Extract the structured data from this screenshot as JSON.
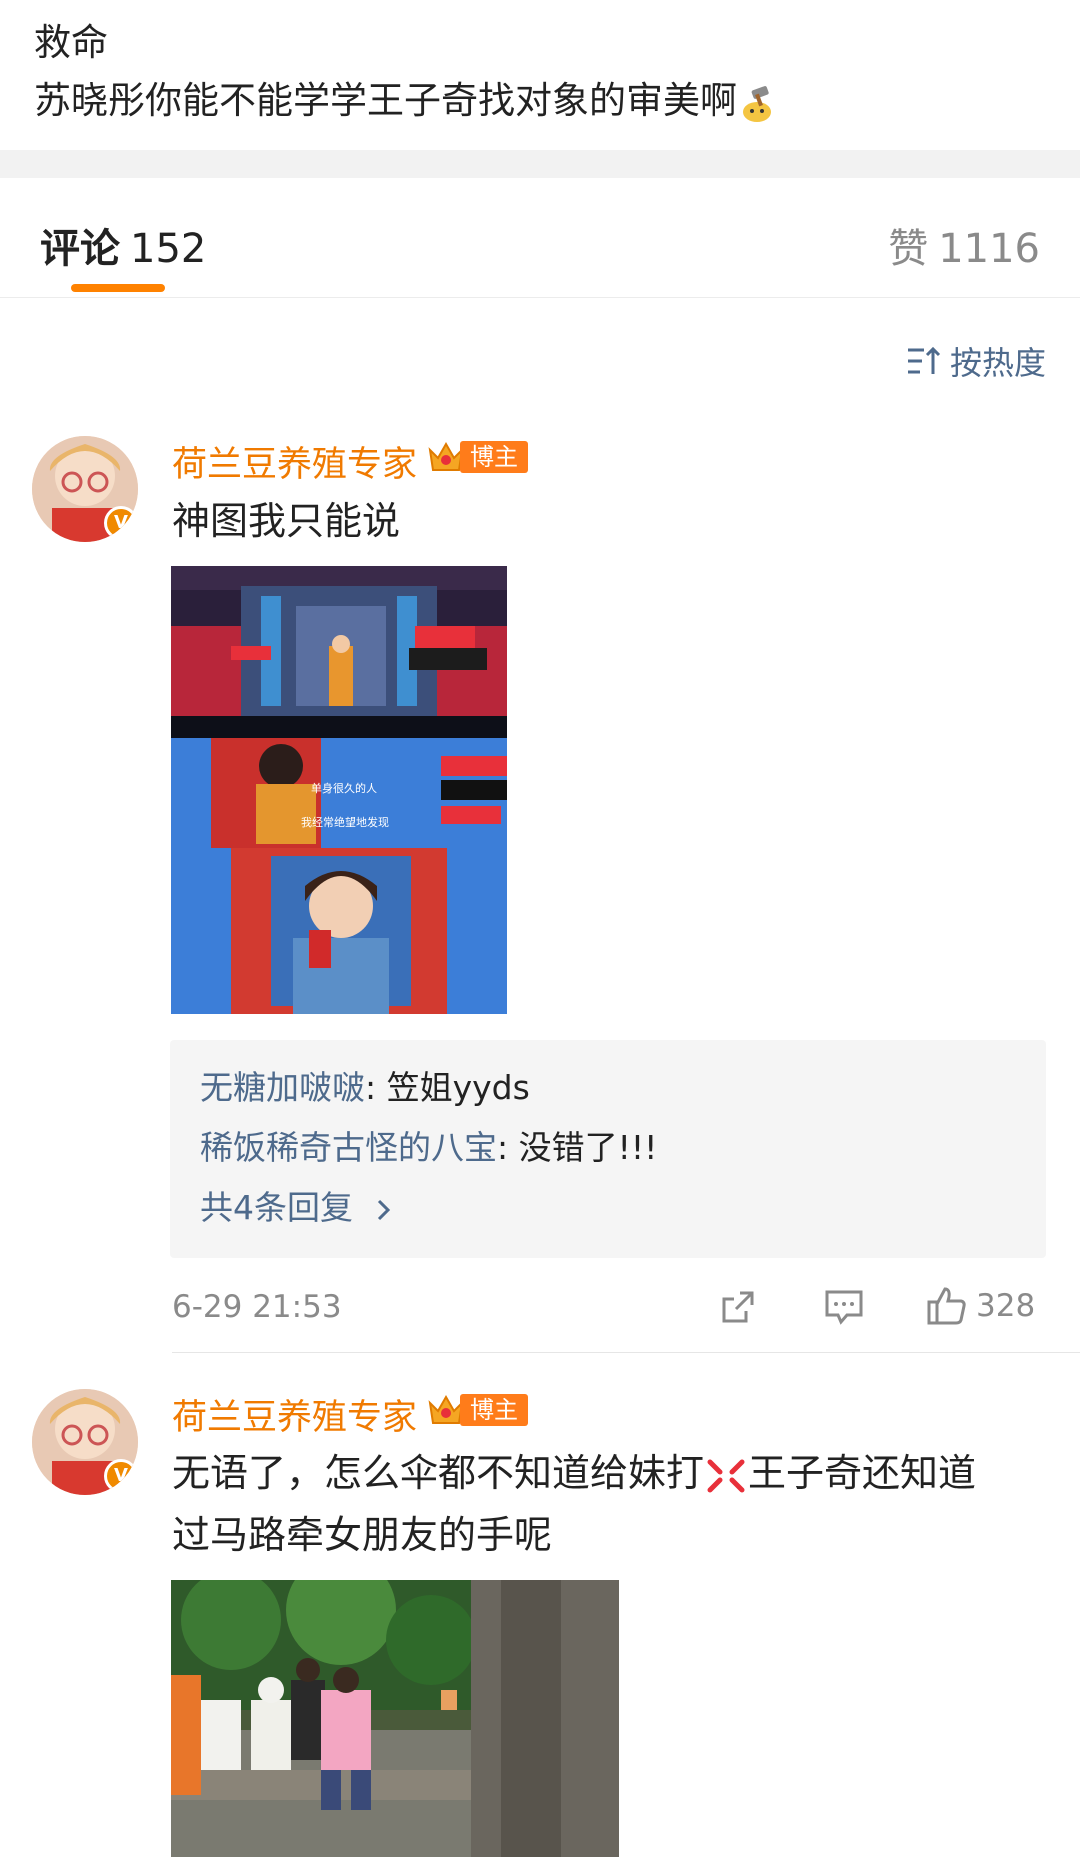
{
  "post": {
    "line1": "救命",
    "line2": "苏晓彤你能不能学学王子奇找对象的审美啊",
    "emoji_name": "hammer-emoji"
  },
  "tabs": {
    "comments_label": "评论",
    "comments_count": "152",
    "likes_label": "赞",
    "likes_count": "1116"
  },
  "sort": {
    "label": "按热度"
  },
  "comments": [
    {
      "username": "荷兰豆养殖专家",
      "badge": "博主",
      "verified": "V",
      "text": "神图我只能说",
      "image_caption_lines": [
        "单身很久的人",
        "我经常绝望地发现"
      ],
      "replies": [
        {
          "name": "无糖加啵啵",
          "text": ": 笠姐yyds"
        },
        {
          "name": "稀饭稀奇古怪的八宝",
          "text": ": 没错了!!!"
        }
      ],
      "more_replies": "共4条回复",
      "time": "6-29 21:53",
      "like_count": "328"
    },
    {
      "username": "荷兰豆养殖专家",
      "badge": "博主",
      "verified": "V",
      "text_line1": "无语了，怎么伞都不知道给妹打",
      "text_line2": "王子奇还知道",
      "text_line3": "过马路牵女朋友的手呢",
      "emoji_name": "angry-emoji"
    }
  ],
  "colors": {
    "accent": "#ff8200",
    "username": "#f07a00",
    "link": "#4e6a8c",
    "muted": "#8a8a8a"
  }
}
